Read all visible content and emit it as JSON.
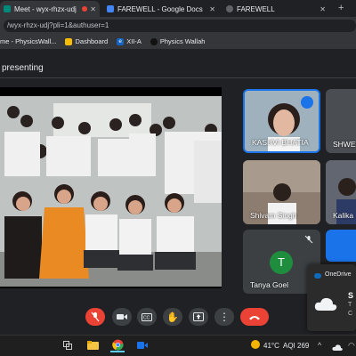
{
  "browser": {
    "tabs": [
      {
        "label": "Meet - wyx-rhzx-udj",
        "active": true
      },
      {
        "label": "FAREWELL - Google Docs",
        "active": false
      },
      {
        "label": "FAREWELL",
        "active": false
      }
    ],
    "url": "/wyx-rhzx-udj?pli=1&authuser=1",
    "bookmarks": [
      "me - PhysicsWall...",
      "Dashboard",
      "XII-A",
      "Physics Wallah"
    ]
  },
  "meet": {
    "presenting_label": "presenting",
    "participants": [
      {
        "name": "KASHVI BHATIA",
        "speaking": true
      },
      {
        "name": "SHWETA",
        "speaking": false
      },
      {
        "name": "Shivam Singh",
        "speaking": false
      },
      {
        "name": "Kalika",
        "speaking": false
      },
      {
        "name": "Tanya Goel",
        "initial": "T",
        "muted": true
      }
    ]
  },
  "toolbar": {
    "buttons": [
      "mic-off",
      "camera",
      "captions",
      "raise-hand",
      "present",
      "more",
      "end-call"
    ]
  },
  "notification": {
    "app": "OneDrive",
    "title_fragment": "S",
    "line1_fragment": "T",
    "line2_fragment": "C"
  },
  "taskbar": {
    "weather": "41°C",
    "aqi": "AQI 269",
    "colors": {
      "accent": "#1a73e8",
      "end": "#ea4335",
      "avatar": "#1e8e3e"
    }
  }
}
